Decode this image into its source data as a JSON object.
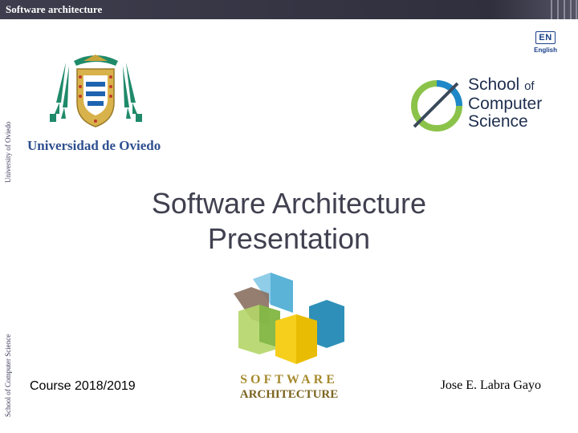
{
  "header": {
    "title": "Software architecture"
  },
  "side": {
    "university": "University of Oviedo",
    "school": "School of Computer Science"
  },
  "language": {
    "code": "EN",
    "label": "English"
  },
  "university_logo": {
    "name": "Universidad de Oviedo"
  },
  "school_logo": {
    "line1": "School",
    "of": "of",
    "line2": "Computer",
    "line3": "Science"
  },
  "slide": {
    "title_line1": "Software Architecture",
    "title_line2": "Presentation"
  },
  "sw_logo": {
    "word": "SOFTWARE",
    "arch": "ARCHITECTURE"
  },
  "footer": {
    "course": "Course 2018/2019",
    "author": "Jose E. Labra Gayo"
  }
}
